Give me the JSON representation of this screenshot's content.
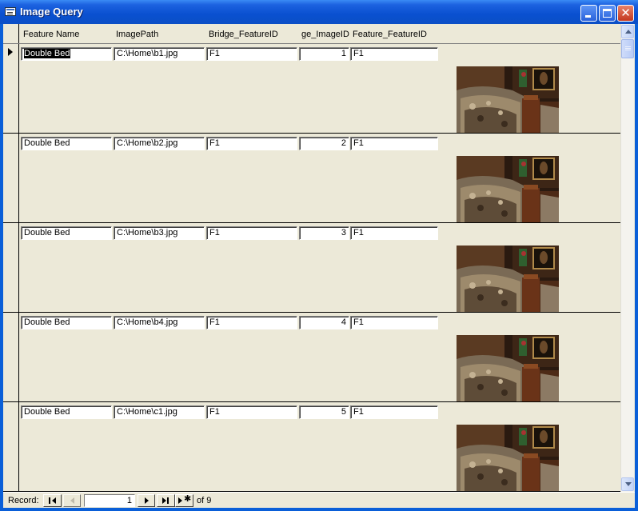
{
  "window": {
    "title": "Image Query"
  },
  "columns": [
    "Feature Name",
    "ImagePath",
    "Bridge_FeatureID",
    "ge_ImageID",
    "Feature_FeatureID"
  ],
  "records": [
    {
      "feature_name": "Double Bed",
      "image_path": "C:\\Home\\b1.jpg",
      "bridge_feature_id": "F1",
      "image_id": "1",
      "feature_feature_id": "F1"
    },
    {
      "feature_name": "Double Bed",
      "image_path": "C:\\Home\\b2.jpg",
      "bridge_feature_id": "F1",
      "image_id": "2",
      "feature_feature_id": "F1"
    },
    {
      "feature_name": "Double Bed",
      "image_path": "C:\\Home\\b3.jpg",
      "bridge_feature_id": "F1",
      "image_id": "3",
      "feature_feature_id": "F1"
    },
    {
      "feature_name": "Double Bed",
      "image_path": "C:\\Home\\b4.jpg",
      "bridge_feature_id": "F1",
      "image_id": "4",
      "feature_feature_id": "F1"
    },
    {
      "feature_name": "Double Bed",
      "image_path": "C:\\Home\\c1.jpg",
      "bridge_feature_id": "F1",
      "image_id": "5",
      "feature_feature_id": "F1"
    }
  ],
  "navigation": {
    "label": "Record:",
    "current": "1",
    "of_label": "of",
    "total": "9"
  },
  "icons": {
    "app": "form-icon",
    "minimize": "minimize-icon",
    "maximize": "maximize-icon",
    "close": "close-icon",
    "first": "first-record-icon",
    "prev": "previous-record-icon",
    "next": "next-record-icon",
    "last": "last-record-icon",
    "new": "new-record-icon"
  },
  "colors": {
    "titlebar": "#0a50d0",
    "client": "#ece9d8",
    "close_button": "#c4381f"
  }
}
